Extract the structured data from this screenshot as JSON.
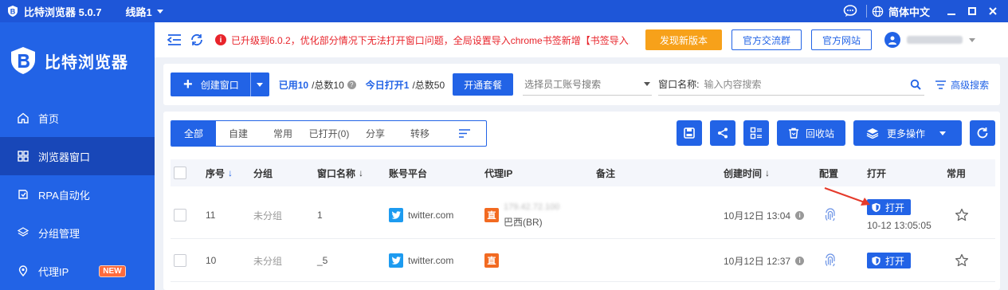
{
  "titlebar": {
    "app_title": "比特浏览器 5.0.7",
    "route": "线路1",
    "language": "简体中文"
  },
  "sidebar": {
    "brand": "比特浏览器",
    "items": [
      {
        "label": "首页",
        "icon": "home-icon"
      },
      {
        "label": "浏览器窗口",
        "icon": "grid-icon"
      },
      {
        "label": "RPA自动化",
        "icon": "rpa-icon"
      },
      {
        "label": "分组管理",
        "icon": "layers-icon"
      },
      {
        "label": "代理IP",
        "icon": "location-icon",
        "badge": "NEW"
      }
    ],
    "active_index": 1
  },
  "header": {
    "notice": "已升级到6.0.2，优化部分情况下无法打开窗口问题，全局设置导入chrome书签新增【书签导入...",
    "new_version_label": "发现新版本",
    "group_label": "官方交流群",
    "website_label": "官方网站"
  },
  "toolbar": {
    "create_label": "创建窗口",
    "used_prefix": "已用",
    "used_count": "10",
    "total_text": "/总数10",
    "today_prefix": "今日打开",
    "today_count": "1",
    "today_total_text": "/总数50",
    "package_label": "开通套餐",
    "employee_placeholder": "选择员工账号搜索",
    "window_name_label": "窗口名称:",
    "search_placeholder": "输入内容搜索",
    "advanced_label": "高级搜索"
  },
  "tabs": [
    {
      "label": "全部",
      "active": true
    },
    {
      "label": "自建",
      "active": false
    },
    {
      "label": "常用",
      "active": false
    },
    {
      "label": "已打开(0)",
      "active": false
    },
    {
      "label": "分享",
      "active": false
    },
    {
      "label": "转移",
      "active": false
    }
  ],
  "actions": {
    "recycle_label": "回收站",
    "more_label": "更多操作"
  },
  "table": {
    "headers": {
      "seq": "序号",
      "group": "分组",
      "name": "窗口名称",
      "platform": "账号平台",
      "proxy": "代理IP",
      "note": "备注",
      "created": "创建时间",
      "config": "配置",
      "open": "打开",
      "favorite": "常用"
    },
    "rows": [
      {
        "seq": "11",
        "group": "未分组",
        "name": "1",
        "platform": "twitter.com",
        "proxy_tag": "直",
        "proxy_ip": "179.42.72.100",
        "proxy_region": "巴西(BR)",
        "created": "10月12日 13:04",
        "open_label": "打开",
        "last_open": "10-12 13:05:05"
      },
      {
        "seq": "10",
        "group": "未分组",
        "name": "_5",
        "platform": "twitter.com",
        "proxy_tag": "直",
        "proxy_ip": "",
        "proxy_region": "",
        "created": "10月12日 12:37",
        "open_label": "打开",
        "last_open": ""
      }
    ]
  },
  "colors": {
    "primary": "#2263e6",
    "sidebar_active": "#1847b8",
    "orange": "#f7a11a",
    "notice_red": "#e8242b",
    "twitter": "#1d9bf0",
    "proxy_tag": "#f26a21",
    "arrow": "#e53a2b"
  }
}
